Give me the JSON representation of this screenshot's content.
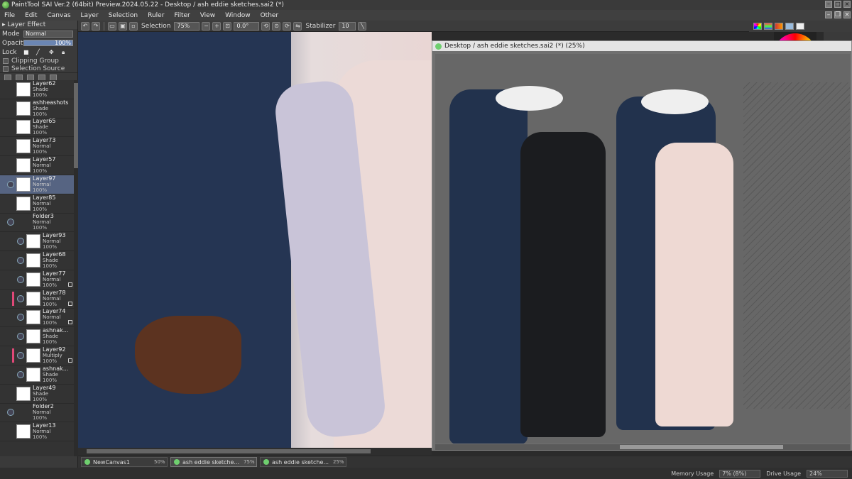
{
  "window": {
    "title": "PaintTool SAI Ver.2 (64bit) Preview.2024.05.22 - Desktop / ash eddie sketches.sai2 (*)"
  },
  "menu": [
    "File",
    "Edit",
    "Canvas",
    "Layer",
    "Selection",
    "Ruler",
    "Filter",
    "View",
    "Window",
    "Other"
  ],
  "toolbar": {
    "selection_label": "Selection",
    "zoom_value": "75%",
    "angle_value": "0.0°",
    "stabilizer_label": "Stabilizer",
    "stabilizer_value": "10"
  },
  "layer_panel": {
    "header": "Layer Effect",
    "mode_label": "Mode",
    "mode_value": "Normal",
    "opacity_label": "Opacity",
    "opacity_value": "100%",
    "opacity_fraction": 1.0,
    "lock_label": "Lock",
    "clipping_group": "Clipping Group",
    "selection_source": "Selection Source"
  },
  "layers": [
    {
      "name": "Layer62",
      "mode": "Shade",
      "opacity": "100%"
    },
    {
      "name": "ashheashots",
      "mode": "Shade",
      "opacity": "100%"
    },
    {
      "name": "Layer65",
      "mode": "Shade",
      "opacity": "100%"
    },
    {
      "name": "Layer73",
      "mode": "Normal",
      "opacity": "100%"
    },
    {
      "name": "Layer57",
      "mode": "Normal",
      "opacity": "100%"
    },
    {
      "name": "Layer97",
      "mode": "Normal",
      "opacity": "100%"
    },
    {
      "name": "Layer85",
      "mode": "Normal",
      "opacity": "100%"
    },
    {
      "name": "Folder3",
      "mode": "Normal",
      "opacity": "100%"
    },
    {
      "name": "Layer93",
      "mode": "Normal",
      "opacity": "100%"
    },
    {
      "name": "Layer68",
      "mode": "Shade",
      "opacity": "100%"
    },
    {
      "name": "Layer77",
      "mode": "Normal",
      "opacity": "100%"
    },
    {
      "name": "Layer78",
      "mode": "Normal",
      "opacity": "100%"
    },
    {
      "name": "Layer74",
      "mode": "Normal",
      "opacity": "100%"
    },
    {
      "name": "ashnak...",
      "mode": "Shade",
      "opacity": "100%"
    },
    {
      "name": "Layer92",
      "mode": "Multiply",
      "opacity": "100%"
    },
    {
      "name": "ashnak...",
      "mode": "Shade",
      "opacity": "100%"
    },
    {
      "name": "Layer49",
      "mode": "Shade",
      "opacity": "100%"
    },
    {
      "name": "Folder2",
      "mode": "Normal",
      "opacity": "100%"
    },
    {
      "name": "Layer13",
      "mode": "Normal",
      "opacity": "100%"
    }
  ],
  "subwindow": {
    "title": "Desktop / ash eddie sketches.sai2 (*) (25%)"
  },
  "tabs": [
    {
      "name": "NewCanvas1",
      "zoom": "50%"
    },
    {
      "name": "ash eddie sketche...",
      "zoom": "75%"
    },
    {
      "name": "ash eddie sketche...",
      "zoom": "25%"
    }
  ],
  "status": {
    "memory_label": "Memory Usage",
    "memory_value": "7% (8%)",
    "drive_label": "Drive Usage",
    "drive_value": "24%"
  },
  "colors": {
    "selected_layer": "#566482",
    "accent_marker": "#e04878"
  },
  "icons": [
    "app-icon",
    "minimize-icon",
    "maximize-icon",
    "close-icon",
    "undo-icon",
    "redo-icon",
    "rotate-icon",
    "eye-icon",
    "lock-icon"
  ]
}
